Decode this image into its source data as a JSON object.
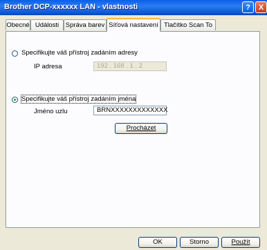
{
  "window": {
    "title": "Brother DCP-xxxxxx LAN - vlastnosti"
  },
  "titlebar_buttons": {
    "help": "?",
    "close": "X"
  },
  "tabs": [
    {
      "label": "Obecné"
    },
    {
      "label": "Události"
    },
    {
      "label": "Správa barev"
    },
    {
      "label": "Síťová nastavení",
      "active": true
    },
    {
      "label": "Tlačítko Scan To"
    }
  ],
  "address_option": {
    "label": "Specifikujte váš přístroj zadáním adresy",
    "selected": false,
    "ip_label": "IP adresa",
    "ip_value": "192 . 168 .   1   .   2"
  },
  "name_option": {
    "label": "Specifikujte váš přístroj zadáním jména",
    "selected": true,
    "node_label": "Jméno uzlu",
    "node_value": "BRNXXXXXXXXXXXXX",
    "browse_button": "Procházet"
  },
  "footer": {
    "ok": "OK",
    "cancel": "Storno",
    "apply": "Použít"
  }
}
